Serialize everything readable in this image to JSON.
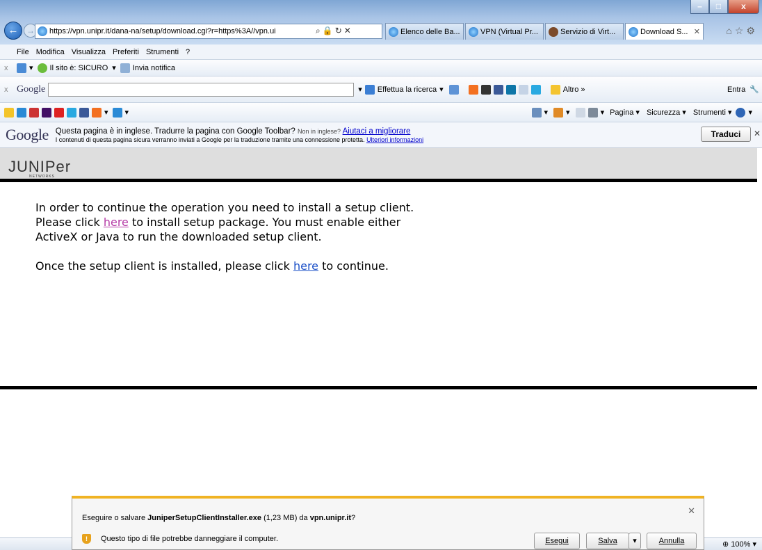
{
  "browser": {
    "url": "https://vpn.unipr.it/dana-na/setup/download.cgi?r=https%3A//vpn.ui",
    "tabs": [
      {
        "label": "Elenco delle Ba...",
        "active": false
      },
      {
        "label": "VPN (Virtual Pr...",
        "active": false
      },
      {
        "label": "Servizio di Virt...",
        "active": false
      },
      {
        "label": "Download S...",
        "active": true
      }
    ],
    "window_buttons": {
      "min": "–",
      "max": "□",
      "close": "x"
    }
  },
  "menubar": [
    "File",
    "Modifica",
    "Visualizza",
    "Preferiti",
    "Strumenti",
    "?"
  ],
  "security_bar": {
    "status": "Il sito è: SICURO",
    "notify": "Invia notifica"
  },
  "google_toolbar": {
    "brand": "Google",
    "search_label": "Effettua la ricerca",
    "more": "Altro »",
    "signin": "Entra"
  },
  "command_bar": {
    "page": "Pagina",
    "security": "Sicurezza",
    "tools": "Strumenti"
  },
  "translate_bar": {
    "logo": "Google",
    "message": "Questa pagina è in inglese. Tradurre la pagina con Google Toolbar?",
    "not_english": "Non in inglese?",
    "help_link": "Aiutaci a migliorare",
    "privacy_text": "I contenuti di questa pagina sicura verranno inviati a Google per la traduzione tramite una connessione protetta.",
    "more_info": "Ulteriori informazioni",
    "translate_button": "Traduci"
  },
  "page": {
    "logo": "JUNIPer",
    "logo_sub": "NETWORKS",
    "para1_a": "In order to continue the operation you need to install a setup client. Please click ",
    "para1_link": "here",
    "para1_b": " to install setup package. You must enable either ActiveX or Java to run the downloaded setup client.",
    "para2_a": "Once the setup client is installed, please click ",
    "para2_link": "here",
    "para2_b": " to continue."
  },
  "download_bar": {
    "prefix": "Eseguire o salvare ",
    "filename": "JuniperSetupClientInstaller.exe",
    "size": " (1,23 MB) da ",
    "host": "vpn.unipr.it",
    "suffix": "?",
    "warning": "Questo tipo di file potrebbe danneggiare il computer.",
    "run": "Esegui",
    "save": "Salva",
    "cancel": "Annulla"
  },
  "status_bar": {
    "zoom": "100%"
  }
}
